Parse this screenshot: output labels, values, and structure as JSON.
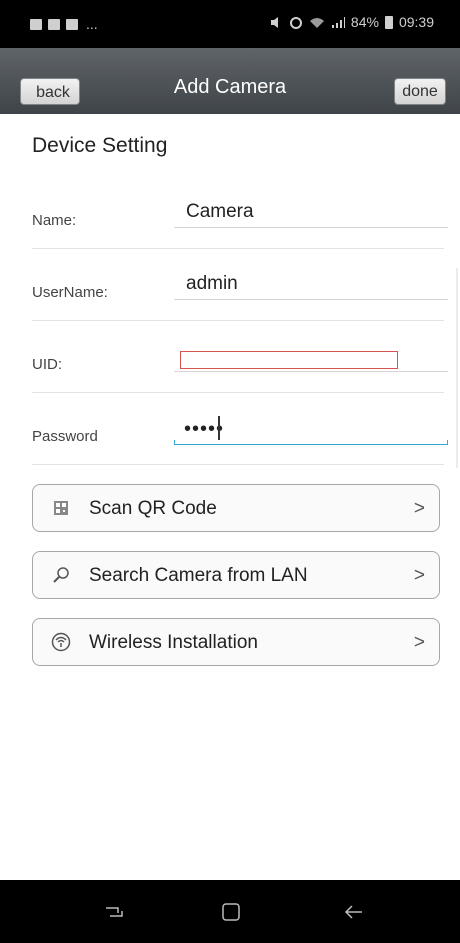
{
  "status_bar": {
    "signal_text": "84%",
    "time": "09:39",
    "overflow": "..."
  },
  "nav": {
    "back_label": "back",
    "title": "Add Camera",
    "done_label": "done"
  },
  "section": {
    "heading": "Device Setting"
  },
  "fields": [
    {
      "label": "Name:",
      "value": "Camera"
    },
    {
      "label": "UserName:",
      "value": "admin"
    },
    {
      "label": "UID:",
      "value": ""
    },
    {
      "label": "Password",
      "value": "•••••"
    }
  ],
  "actions": [
    {
      "label": "Scan QR Code",
      "icon": "qr-code-icon"
    },
    {
      "label": "Search Camera from LAN",
      "icon": "search-icon"
    },
    {
      "label": "Wireless Installation",
      "icon": "wireless-icon"
    }
  ],
  "bottom_nav": {
    "keys": [
      "recent-apps-icon",
      "home-icon",
      "back-arrow-icon"
    ]
  },
  "colors": {
    "accent": "#35a4d6",
    "uid_error_border": "#d9534f",
    "navbar_top": "#5f6469",
    "navbar_bottom": "#3f4449"
  }
}
